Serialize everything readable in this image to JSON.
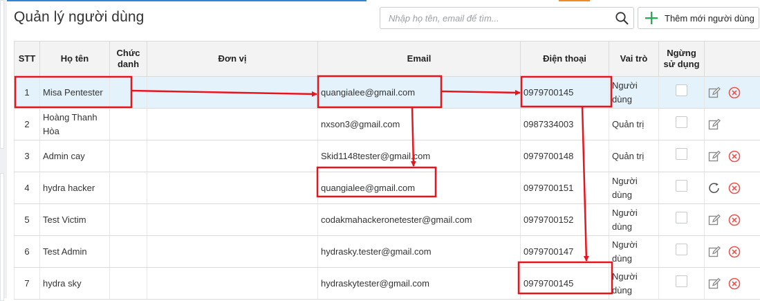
{
  "page": {
    "title": "Quản lý người dùng"
  },
  "search": {
    "placeholder": "Nhập họ tên, email để tìm..."
  },
  "toolbar": {
    "add_label": "Thêm mới người dùng"
  },
  "table": {
    "headers": {
      "stt": "STT",
      "name": "Họ tên",
      "title": "Chức danh",
      "unit": "Đơn vị",
      "email": "Email",
      "phone": "Điện thoại",
      "role": "Vai trò",
      "disabled": "Ngừng sử dụng"
    },
    "rows": [
      {
        "stt": "1",
        "name": "Misa Pentester",
        "title": "",
        "unit": "",
        "email": "quangialee@gmail.com",
        "phone": "0979700145",
        "role": "Người dùng",
        "disabled": false,
        "actions": [
          "edit",
          "delete"
        ]
      },
      {
        "stt": "2",
        "name": "Hoàng Thanh Hòa",
        "title": "",
        "unit": "",
        "email": "nxson3@gmail.com",
        "phone": "0987334003",
        "role": "Quản trị",
        "disabled": false,
        "actions": [
          "edit"
        ]
      },
      {
        "stt": "3",
        "name": "Admin cay",
        "title": "",
        "unit": "",
        "email": "Skid1148tester@gmail.com",
        "phone": "0979700148",
        "role": "Quản trị",
        "disabled": false,
        "actions": [
          "edit",
          "delete"
        ]
      },
      {
        "stt": "4",
        "name": "hydra hacker",
        "title": "",
        "unit": "",
        "email": "quangialee@gmail.com",
        "phone": "0979700151",
        "role": "Người dùng",
        "disabled": false,
        "actions": [
          "restore",
          "delete"
        ]
      },
      {
        "stt": "5",
        "name": "Test Victim",
        "title": "",
        "unit": "",
        "email": "codakmahackeronetester@gmail.com",
        "phone": "0979700152",
        "role": "Người dùng",
        "disabled": false,
        "actions": [
          "edit",
          "delete"
        ]
      },
      {
        "stt": "6",
        "name": "Test Admin",
        "title": "",
        "unit": "",
        "email": "hydrasky.tester@gmail.com",
        "phone": "0979700147",
        "role": "Người dùng",
        "disabled": false,
        "actions": [
          "edit",
          "delete"
        ]
      },
      {
        "stt": "7",
        "name": "hydra sky",
        "title": "",
        "unit": "",
        "email": "hydraskytester@gmail.com",
        "phone": "0979700145",
        "role": "Người dùng",
        "disabled": false,
        "actions": [
          "edit",
          "delete"
        ]
      }
    ],
    "selected_row": 0
  },
  "icons": {
    "search": "search-icon",
    "add": "plus-icon",
    "edit": "edit-icon",
    "delete": "delete-icon",
    "restore": "restore-icon"
  },
  "colors": {
    "accent_blue": "#2f86d6",
    "accent_orange": "#f08a24",
    "add_green": "#2bab5a",
    "delete_red": "#e8554e",
    "selected_row": "#e4f2fb",
    "annotation_red": "#e8141c"
  }
}
